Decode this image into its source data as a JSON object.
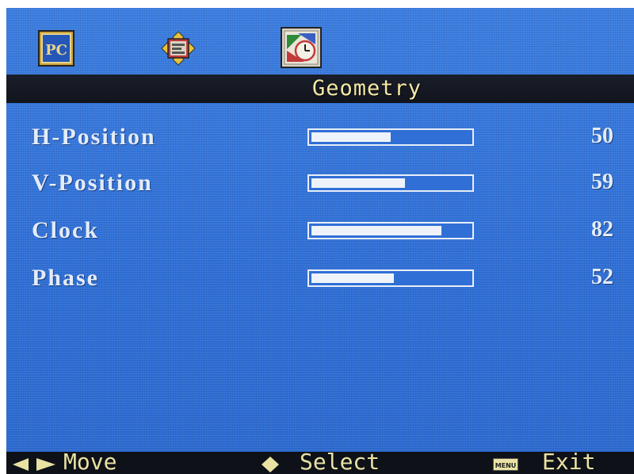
{
  "tabs": [
    {
      "name": "pc",
      "icon": "pc-icon",
      "label": "PC"
    },
    {
      "name": "image",
      "icon": "image-settings-icon"
    },
    {
      "name": "geometry",
      "icon": "geometry-clock-icon",
      "active": true
    }
  ],
  "title": "Geometry",
  "settings": [
    {
      "label": "H-Position",
      "value": "50",
      "level": 0.5
    },
    {
      "label": "V-Position",
      "value": "59",
      "level": 0.59
    },
    {
      "label": "Clock",
      "value": "82",
      "level": 0.82
    },
    {
      "label": "Phase",
      "value": "52",
      "level": 0.52
    }
  ],
  "footer": {
    "move": {
      "icon": "left-right-arrows-icon",
      "label": "Move"
    },
    "select": {
      "icon": "diamond-icon",
      "label": "Select"
    },
    "exit": {
      "icon": "menu-key-icon",
      "icon_text": "MENU",
      "label": "Exit"
    }
  },
  "colors": {
    "background": "#2f6fd6",
    "title_text": "#f3e9a6",
    "label_text": "#e3ecf7",
    "band": "#11141c"
  }
}
